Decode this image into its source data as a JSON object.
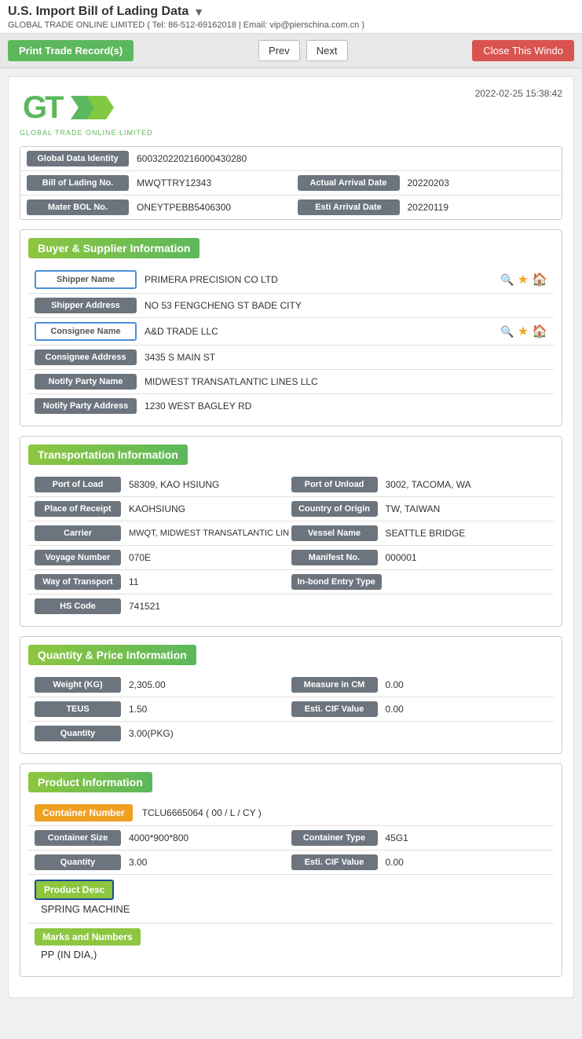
{
  "header": {
    "title": "U.S. Import Bill of Lading Data",
    "subtitle": "GLOBAL TRADE ONLINE LIMITED ( Tel: 86-512-69162018 | Email: vip@pierschina.com.cn )"
  },
  "toolbar": {
    "print_label": "Print Trade Record(s)",
    "prev_label": "Prev",
    "next_label": "Next",
    "close_label": "Close This Windo"
  },
  "doc": {
    "logo_text": "GTO",
    "logo_subtitle": "GLOBAL TRADE ONLINE LIMITED",
    "date": "2022-02-25 15:38:42",
    "global_data_identity_label": "Global Data Identity",
    "global_data_identity_value": "600320220216000430280",
    "bol_no_label": "Bill of Lading No.",
    "bol_no_value": "MWQTTRY12343",
    "actual_arrival_date_label": "Actual Arrival Date",
    "actual_arrival_date_value": "20220203",
    "master_bol_label": "Mater BOL No.",
    "master_bol_value": "ONEYTPEBB5406300",
    "esti_arrival_label": "Esti Arrival Date",
    "esti_arrival_value": "20220119"
  },
  "buyer_supplier": {
    "section_title": "Buyer & Supplier Information",
    "shipper_name_label": "Shipper Name",
    "shipper_name_value": "PRIMERA PRECISION CO LTD",
    "shipper_address_label": "Shipper Address",
    "shipper_address_value": "NO 53 FENGCHENG ST BADE CITY",
    "consignee_name_label": "Consignee Name",
    "consignee_name_value": "A&D TRADE LLC",
    "consignee_address_label": "Consignee Address",
    "consignee_address_value": "3435 S MAIN ST",
    "notify_party_name_label": "Notify Party Name",
    "notify_party_name_value": "MIDWEST TRANSATLANTIC LINES LLC",
    "notify_party_address_label": "Notify Party Address",
    "notify_party_address_value": "1230 WEST BAGLEY RD"
  },
  "transportation": {
    "section_title": "Transportation Information",
    "port_of_load_label": "Port of Load",
    "port_of_load_value": "58309, KAO HSIUNG",
    "port_of_unload_label": "Port of Unload",
    "port_of_unload_value": "3002, TACOMA, WA",
    "place_of_receipt_label": "Place of Receipt",
    "place_of_receipt_value": "KAOHSIUNG",
    "country_of_origin_label": "Country of Origin",
    "country_of_origin_value": "TW, TAIWAN",
    "carrier_label": "Carrier",
    "carrier_value": "MWQT, MIDWEST TRANSATLANTIC LIN",
    "vessel_name_label": "Vessel Name",
    "vessel_name_value": "SEATTLE BRIDGE",
    "voyage_number_label": "Voyage Number",
    "voyage_number_value": "070E",
    "manifest_no_label": "Manifest No.",
    "manifest_no_value": "000001",
    "way_of_transport_label": "Way of Transport",
    "way_of_transport_value": "11",
    "inbond_entry_label": "In-bond Entry Type",
    "inbond_entry_value": "",
    "hs_code_label": "HS Code",
    "hs_code_value": "741521"
  },
  "quantity_price": {
    "section_title": "Quantity & Price Information",
    "weight_label": "Weight (KG)",
    "weight_value": "2,305.00",
    "measure_cm_label": "Measure in CM",
    "measure_cm_value": "0.00",
    "teus_label": "TEUS",
    "teus_value": "1.50",
    "esti_cif_label": "Esti. CIF Value",
    "esti_cif_value": "0.00",
    "quantity_label": "Quantity",
    "quantity_value": "3.00(PKG)"
  },
  "product": {
    "section_title": "Product Information",
    "container_number_label": "Container Number",
    "container_number_value": "TCLU6665064 ( 00 / L / CY )",
    "container_size_label": "Container Size",
    "container_size_value": "4000*900*800",
    "container_type_label": "Container Type",
    "container_type_value": "45G1",
    "quantity_label": "Quantity",
    "quantity_value": "3.00",
    "esti_cif_label": "Esti. CIF Value",
    "esti_cif_value": "0.00",
    "product_desc_label": "Product Desc",
    "product_desc_value": "SPRING MACHINE",
    "marks_label": "Marks and Numbers",
    "marks_value": "PP (IN DIA,)"
  }
}
